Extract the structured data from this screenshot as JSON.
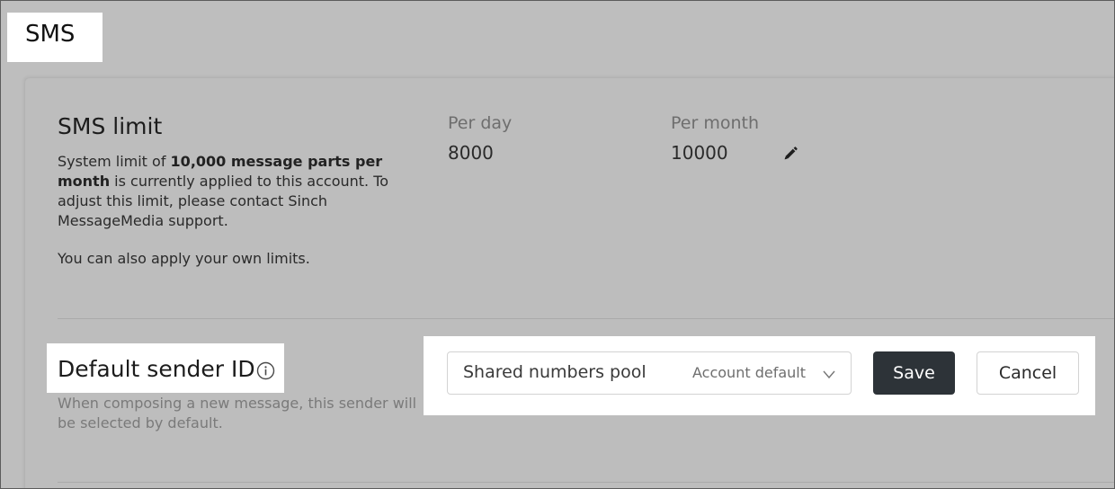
{
  "page": {
    "title": "SMS"
  },
  "sms_limit": {
    "title": "SMS limit",
    "desc_prefix": "System limit of ",
    "desc_bold": "10,000 message parts per month",
    "desc_suffix": " is currently applied to this account. To adjust this limit, please contact Sinch MessageMedia support.",
    "desc_own": "You can also apply your own limits.",
    "per_day_label": "Per day",
    "per_day_value": "8000",
    "per_month_label": "Per month",
    "per_month_value": "10000",
    "edit_icon": "pencil-icon"
  },
  "sender_id": {
    "title": "Default sender ID",
    "info_icon": "info-icon",
    "description": "When composing a new message, this sender will be selected by default.",
    "select_value": "Shared numbers pool",
    "select_hint": "Account default",
    "chevron_icon": "chevron-down-icon",
    "save_label": "Save",
    "cancel_label": "Cancel"
  },
  "colors": {
    "primary_button": "#2d3338",
    "overlay_background": "#bebebe",
    "highlight": "#ffffff"
  }
}
